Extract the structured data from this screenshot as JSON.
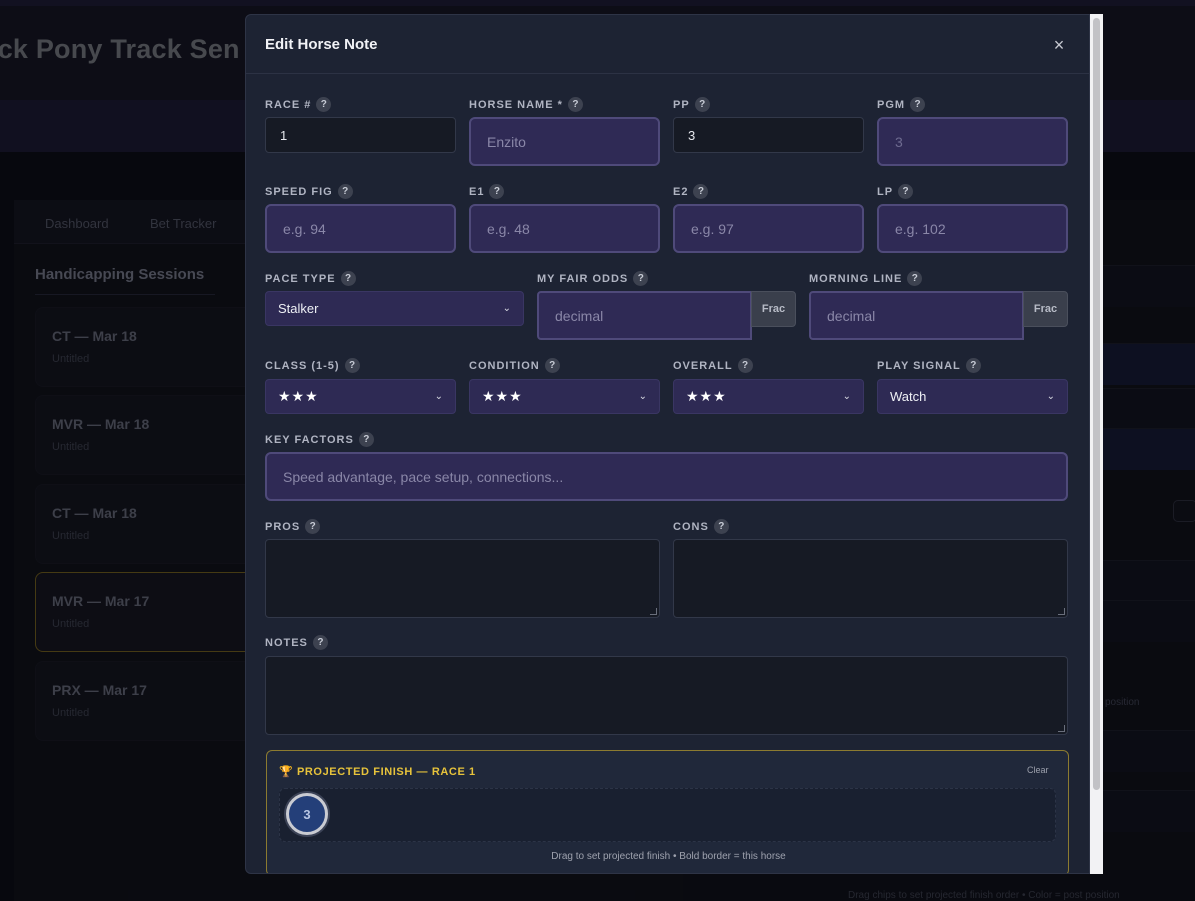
{
  "background": {
    "app_title": "ick Pony Track Sen",
    "nav": [
      "Dashboard",
      "Bet Tracker"
    ],
    "sidebar_title": "Handicapping Sessions",
    "sessions": [
      {
        "title": "CT — Mar 18",
        "subtitle": "Untitled"
      },
      {
        "title": "MVR — Mar 18",
        "subtitle": "Untitled"
      },
      {
        "title": "CT — Mar 18",
        "subtitle": "Untitled"
      },
      {
        "title": "MVR — Mar 17",
        "subtitle": "Untitled"
      },
      {
        "title": "PRX — Mar 17",
        "subtitle": "Untitled"
      }
    ],
    "right_snippet": "position",
    "bottom_hint": "Drag chips to set projected finish order • Color = post position"
  },
  "modal": {
    "title": "Edit Horse Note",
    "close_icon": "×",
    "help_glyph": "?",
    "fields": {
      "race": {
        "label": "RACE #",
        "value": "1"
      },
      "horse_name": {
        "label": "HORSE NAME *",
        "placeholder": "Enzito"
      },
      "pp": {
        "label": "PP",
        "value": "3"
      },
      "pgm": {
        "label": "PGM",
        "placeholder": "3"
      },
      "speed_fig": {
        "label": "SPEED FIG",
        "placeholder": "e.g. 94"
      },
      "e1": {
        "label": "E1",
        "placeholder": "e.g. 48"
      },
      "e2": {
        "label": "E2",
        "placeholder": "e.g. 97"
      },
      "lp": {
        "label": "LP",
        "placeholder": "e.g. 102"
      },
      "pace_type": {
        "label": "PACE TYPE",
        "value": "Stalker"
      },
      "fair_odds": {
        "label": "MY FAIR ODDS",
        "placeholder": "decimal",
        "toggle": "Frac"
      },
      "morning_line": {
        "label": "MORNING LINE",
        "placeholder": "decimal",
        "toggle": "Frac"
      },
      "class": {
        "label": "CLASS (1-5)",
        "value": "★★★"
      },
      "condition": {
        "label": "CONDITION",
        "value": "★★★"
      },
      "overall": {
        "label": "OVERALL",
        "value": "★★★"
      },
      "play_signal": {
        "label": "PLAY SIGNAL",
        "value": "Watch"
      },
      "key_factors": {
        "label": "KEY FACTORS",
        "placeholder": "Speed advantage, pace setup, connections..."
      },
      "pros": {
        "label": "PROS"
      },
      "cons": {
        "label": "CONS"
      },
      "notes": {
        "label": "NOTES"
      }
    },
    "projected": {
      "icon": "🏆",
      "title": "PROJECTED FINISH — RACE 1",
      "clear_label": "Clear",
      "chip_label": "3",
      "hint": "Drag to set projected finish • Bold border = this horse"
    }
  },
  "colors": {
    "accent_gold": "#e7c33b",
    "input_purple": "#2f2a55",
    "modal_bg": "#1d2333",
    "chip_blue": "#243f79"
  }
}
